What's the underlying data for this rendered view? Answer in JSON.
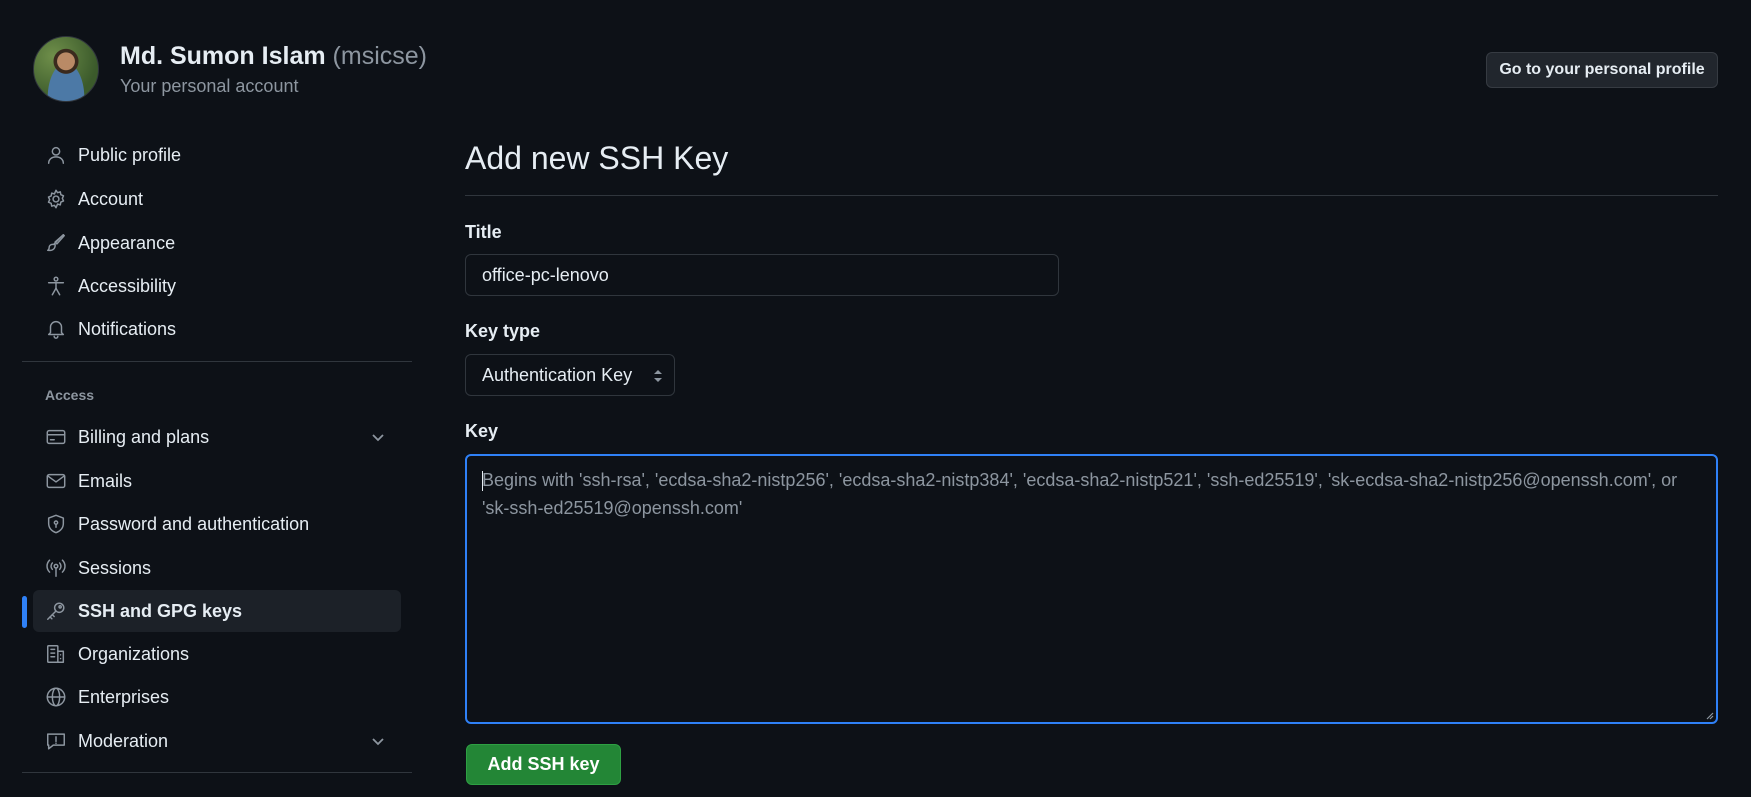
{
  "account": {
    "name": "Md. Sumon Islam",
    "login": "(msicse)",
    "subtitle": "Your personal account",
    "profile_button": "Go to your personal profile"
  },
  "sidebar": {
    "items": [
      {
        "label": "Public profile",
        "icon": "person-icon"
      },
      {
        "label": "Account",
        "icon": "gear-icon"
      },
      {
        "label": "Appearance",
        "icon": "paintbrush-icon"
      },
      {
        "label": "Accessibility",
        "icon": "accessibility-icon"
      },
      {
        "label": "Notifications",
        "icon": "bell-icon"
      }
    ],
    "access_label": "Access",
    "access_items": [
      {
        "label": "Billing and plans",
        "icon": "credit-card-icon"
      },
      {
        "label": "Emails",
        "icon": "mail-icon"
      },
      {
        "label": "Password and authentication",
        "icon": "shield-lock-icon"
      },
      {
        "label": "Sessions",
        "icon": "broadcast-icon"
      },
      {
        "label": "SSH and GPG keys",
        "icon": "key-icon",
        "active": true
      },
      {
        "label": "Organizations",
        "icon": "organization-icon"
      },
      {
        "label": "Enterprises",
        "icon": "globe-icon"
      },
      {
        "label": "Moderation",
        "icon": "report-icon"
      }
    ]
  },
  "form": {
    "page_title": "Add new SSH Key",
    "title_label": "Title",
    "title_value": "office-pc-lenovo",
    "key_type_label": "Key type",
    "key_type_value": "Authentication Key",
    "key_label": "Key",
    "key_value": "",
    "key_placeholder": "Begins with 'ssh-rsa', 'ecdsa-sha2-nistp256', 'ecdsa-sha2-nistp384', 'ecdsa-sha2-nistp521', 'ssh-ed25519', 'sk-ecdsa-sha2-nistp256@openssh.com', or 'sk-ssh-ed25519@openssh.com'",
    "submit_label": "Add SSH key"
  },
  "colors": {
    "background": "#0d1117",
    "accent": "#2f81f7",
    "primary_button": "#238636",
    "muted_text": "#8d96a0"
  }
}
